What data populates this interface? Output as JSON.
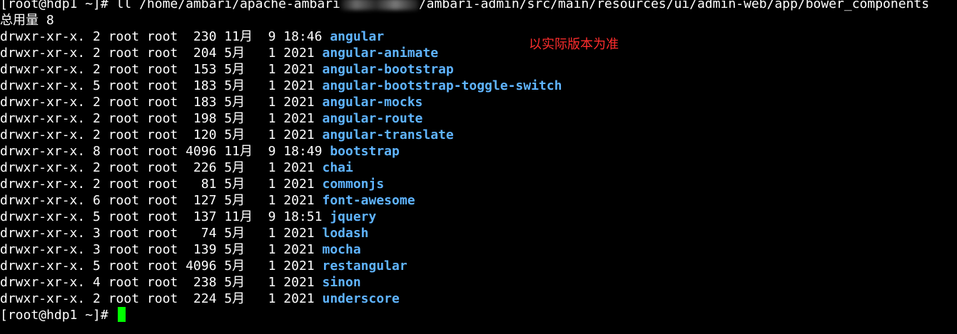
{
  "terminal": {
    "command_line": {
      "prompt": "[root@hdp1 ~]# ",
      "command_start": "ll /home/ambari/apache-ambari",
      "command_end": "/ambari-admin/src/main/resources/ui/admin-web/app/bower_components"
    },
    "total_line": "总用量 8",
    "entries": [
      {
        "meta": "drwxr-xr-x. 2 root root  230 11月  9 18:46 ",
        "name": "angular"
      },
      {
        "meta": "drwxr-xr-x. 2 root root  204 5月   1 2021 ",
        "name": "angular-animate"
      },
      {
        "meta": "drwxr-xr-x. 2 root root  153 5月   1 2021 ",
        "name": "angular-bootstrap"
      },
      {
        "meta": "drwxr-xr-x. 5 root root  183 5月   1 2021 ",
        "name": "angular-bootstrap-toggle-switch"
      },
      {
        "meta": "drwxr-xr-x. 2 root root  183 5月   1 2021 ",
        "name": "angular-mocks"
      },
      {
        "meta": "drwxr-xr-x. 2 root root  198 5月   1 2021 ",
        "name": "angular-route"
      },
      {
        "meta": "drwxr-xr-x. 2 root root  120 5月   1 2021 ",
        "name": "angular-translate"
      },
      {
        "meta": "drwxr-xr-x. 8 root root 4096 11月  9 18:49 ",
        "name": "bootstrap"
      },
      {
        "meta": "drwxr-xr-x. 2 root root  226 5月   1 2021 ",
        "name": "chai"
      },
      {
        "meta": "drwxr-xr-x. 2 root root   81 5月   1 2021 ",
        "name": "commonjs"
      },
      {
        "meta": "drwxr-xr-x. 6 root root  127 5月   1 2021 ",
        "name": "font-awesome"
      },
      {
        "meta": "drwxr-xr-x. 5 root root  137 11月  9 18:51 ",
        "name": "jquery"
      },
      {
        "meta": "drwxr-xr-x. 3 root root   74 5月   1 2021 ",
        "name": "lodash"
      },
      {
        "meta": "drwxr-xr-x. 3 root root  139 5月   1 2021 ",
        "name": "mocha"
      },
      {
        "meta": "drwxr-xr-x. 5 root root 4096 5月   1 2021 ",
        "name": "restangular"
      },
      {
        "meta": "drwxr-xr-x. 4 root root  238 5月   1 2021 ",
        "name": "sinon"
      },
      {
        "meta": "drwxr-xr-x. 2 root root  224 5月   1 2021 ",
        "name": "underscore"
      }
    ],
    "final_prompt": "[root@hdp1 ~]# ",
    "annotation": "以实际版本为准"
  },
  "colors": {
    "background": "#000000",
    "text": "#ffffff",
    "directory": "#5fb4ff",
    "annotation": "#ff2d2d",
    "cursor": "#00ff00"
  },
  "icons": {
    "cursor": "block-cursor-icon"
  }
}
